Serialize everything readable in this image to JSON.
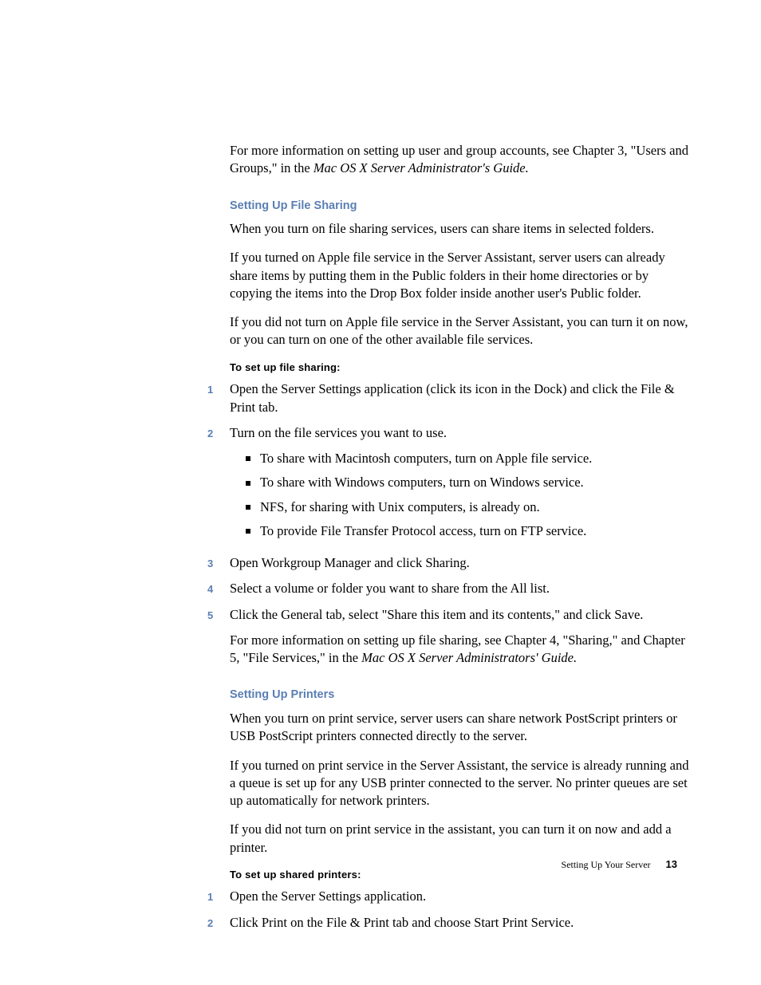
{
  "intro": {
    "p1a": "For more information on setting up user and group accounts, see Chapter 3, \"Users and Groups,\" in the ",
    "p1b": "Mac OS X Server Administrator's Guide."
  },
  "file_sharing": {
    "heading": "Setting Up File Sharing",
    "p1": "When you turn on file sharing services, users can share items in selected folders.",
    "p2": "If you turned on Apple file service in the Server Assistant, server users can already share items by putting them in the Public folders in their home directories or by copying the items into the Drop Box folder inside another user's Public folder.",
    "p3": "If you did not turn on Apple file service in the Server Assistant, you can turn it on now, or you can turn on one of the other available file services.",
    "proc_label": "To set up file sharing:",
    "steps": [
      "Open the Server Settings application (click its icon in the Dock) and click the File & Print tab.",
      "Turn on the file services you want to use.",
      "Open Workgroup Manager and click Sharing.",
      "Select a volume or folder you want to share from the All list.",
      "Click the General tab, select \"Share this item and its contents,\" and click Save."
    ],
    "sub_bullets": [
      "To share with Macintosh computers, turn on Apple file service.",
      "To share with Windows computers, turn on Windows service.",
      "NFS, for sharing with Unix computers, is already on.",
      "To provide File Transfer Protocol access, turn on FTP service."
    ],
    "after_a": "For more information on setting up file sharing, see Chapter 4, \"Sharing,\" and Chapter 5, \"File Services,\" in the ",
    "after_b": "Mac OS X Server Administrators' Guide."
  },
  "printers": {
    "heading": "Setting Up Printers",
    "p1": "When you turn on print service, server users can share network PostScript printers or USB PostScript printers connected directly to the server.",
    "p2": "If you turned on print service in the Server Assistant, the service is already running and a queue is set up for any USB printer connected to the server. No printer queues are set up automatically for network printers.",
    "p3": "If you did not turn on print service in the assistant, you can turn it on now and add a printer.",
    "proc_label": "To set up shared printers:",
    "steps": [
      "Open the Server Settings application.",
      "Click Print on the File & Print tab and choose Start Print Service."
    ]
  },
  "footer": {
    "section": "Setting Up Your Server",
    "page": "13"
  },
  "nums": [
    "1",
    "2",
    "3",
    "4",
    "5"
  ]
}
